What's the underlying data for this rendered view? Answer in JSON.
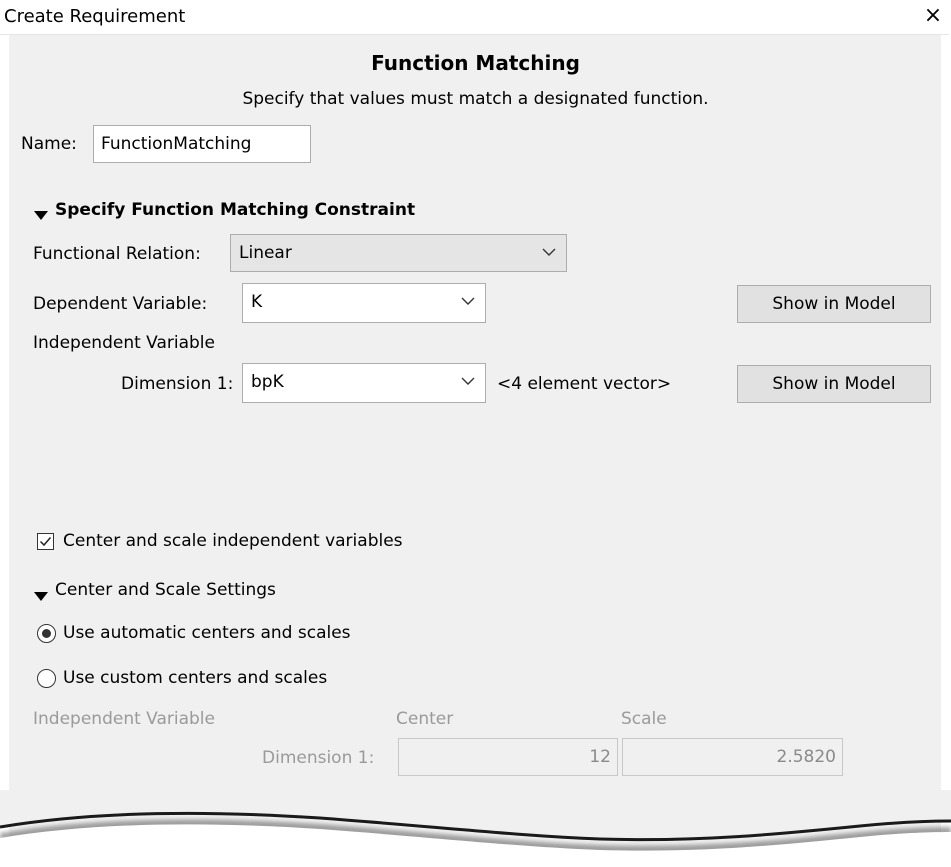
{
  "window": {
    "title": "Create Requirement",
    "close_symbol": "×"
  },
  "header": {
    "title": "Function Matching",
    "description": "Specify that values must match a designated function."
  },
  "name": {
    "label": "Name:",
    "value": "FunctionMatching"
  },
  "constraint_section": {
    "title": "Specify Function Matching Constraint",
    "functional_relation": {
      "label": "Functional Relation:",
      "value": "Linear"
    },
    "dependent_variable": {
      "label": "Dependent Variable:",
      "value": "K",
      "button": "Show in Model"
    },
    "independent_variable": {
      "label": "Independent Variable",
      "dimension_label": "Dimension 1:",
      "value": "bpK",
      "info": "<4 element vector>",
      "button": "Show in Model"
    }
  },
  "center_scale": {
    "checkbox_label": "Center and scale independent variables",
    "checked": true,
    "settings_title": "Center and Scale Settings",
    "options": [
      {
        "label": "Use automatic centers and scales",
        "selected": true
      },
      {
        "label": "Use custom centers and scales",
        "selected": false
      }
    ],
    "table": {
      "headers": [
        "Independent Variable",
        "Center",
        "Scale"
      ],
      "row_label": "Dimension 1:",
      "center": "12",
      "scale": "2.5820"
    }
  }
}
